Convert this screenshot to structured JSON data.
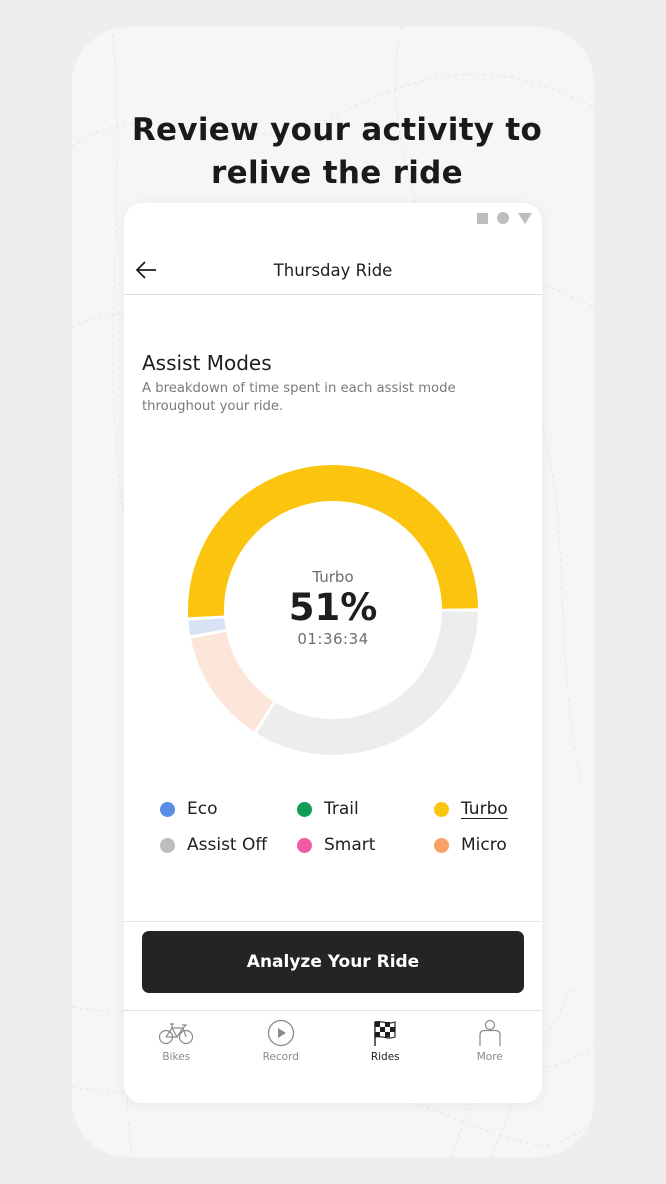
{
  "promo": {
    "headline": "Review your activity to relive the ride"
  },
  "status_bar": {
    "icons": [
      "square-icon",
      "circle-icon",
      "triangle-icon"
    ]
  },
  "appbar": {
    "back_icon": "arrow-left-icon",
    "title": "Thursday Ride"
  },
  "section": {
    "title": "Assist Modes",
    "subtitle": "A breakdown of time spent in each assist mode throughout your ride."
  },
  "donut": {
    "selected_mode": "Turbo",
    "selected_percent": "51%",
    "selected_time": "01:36:34"
  },
  "chart_data": {
    "type": "pie",
    "title": "Assist Modes",
    "variant": "donut",
    "series": [
      {
        "name": "Turbo",
        "value": 51,
        "color": "#FBC50F"
      },
      {
        "name": "Assist Off",
        "value": 34,
        "color": "#EDEDED"
      },
      {
        "name": "Micro",
        "value": 13,
        "color": "#FCE6DA"
      },
      {
        "name": "Eco",
        "value": 2,
        "color": "#D7E3F5"
      }
    ],
    "start_direction": "right (3 o'clock), counter-clockwise for Turbo",
    "center_label": "Turbo 51% 01:36:34"
  },
  "legend": [
    {
      "label": "Eco",
      "color": "#5B8DE6",
      "active": false
    },
    {
      "label": "Trail",
      "color": "#0F9D58",
      "active": false
    },
    {
      "label": "Turbo",
      "color": "#FBC50F",
      "active": true
    },
    {
      "label": "Assist Off",
      "color": "#BDBDBD",
      "active": false
    },
    {
      "label": "Smart",
      "color": "#F15BA6",
      "active": false
    },
    {
      "label": "Micro",
      "color": "#F9A066",
      "active": false
    }
  ],
  "cta": {
    "label": "Analyze Your Ride"
  },
  "tabbar": {
    "items": [
      {
        "label": "Bikes",
        "icon": "bicycle-icon",
        "active": false
      },
      {
        "label": "Record",
        "icon": "play-circle-icon",
        "active": false
      },
      {
        "label": "Rides",
        "icon": "checkered-flag-icon",
        "active": true
      },
      {
        "label": "More",
        "icon": "person-icon",
        "active": false
      }
    ]
  }
}
